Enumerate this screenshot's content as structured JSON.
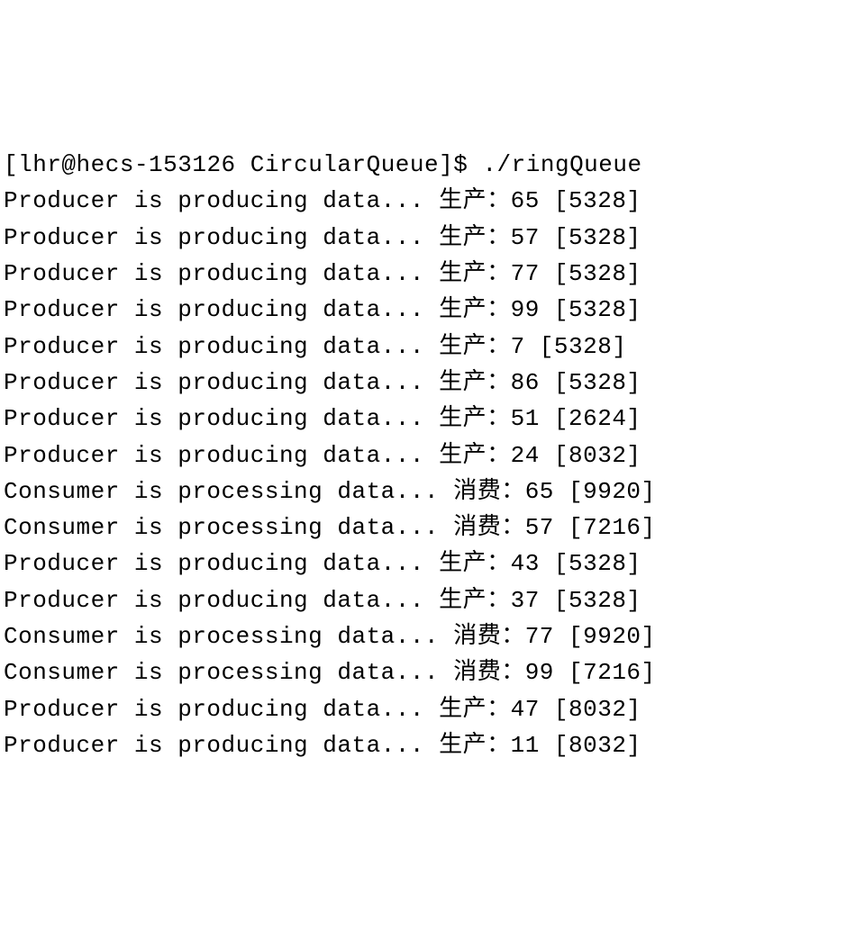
{
  "prompt": {
    "user": "lhr",
    "host": "hecs-153126",
    "directory": "CircularQueue",
    "symbol": "$",
    "command": "./ringQueue"
  },
  "lines": [
    {
      "type": "producer",
      "prefix": "Producer is producing data... ",
      "label": "生产：",
      "value": "65",
      "pid": "5328"
    },
    {
      "type": "producer",
      "prefix": "Producer is producing data... ",
      "label": "生产：",
      "value": "57",
      "pid": "5328"
    },
    {
      "type": "producer",
      "prefix": "Producer is producing data... ",
      "label": "生产：",
      "value": "77",
      "pid": "5328"
    },
    {
      "type": "producer",
      "prefix": "Producer is producing data... ",
      "label": "生产：",
      "value": "99",
      "pid": "5328"
    },
    {
      "type": "producer",
      "prefix": "Producer is producing data... ",
      "label": "生产：",
      "value": "7",
      "pid": "5328"
    },
    {
      "type": "producer",
      "prefix": "Producer is producing data... ",
      "label": "生产：",
      "value": "86",
      "pid": "5328"
    },
    {
      "type": "producer",
      "prefix": "Producer is producing data... ",
      "label": "生产：",
      "value": "51",
      "pid": "2624"
    },
    {
      "type": "producer",
      "prefix": "Producer is producing data... ",
      "label": "生产：",
      "value": "24",
      "pid": "8032"
    },
    {
      "type": "consumer",
      "prefix": "Consumer is processing data... ",
      "label": "消费：",
      "value": "65",
      "pid": "9920"
    },
    {
      "type": "consumer",
      "prefix": "Consumer is processing data... ",
      "label": "消费：",
      "value": "57",
      "pid": "7216"
    },
    {
      "type": "producer",
      "prefix": "Producer is producing data... ",
      "label": "生产：",
      "value": "43",
      "pid": "5328"
    },
    {
      "type": "producer",
      "prefix": "Producer is producing data... ",
      "label": "生产：",
      "value": "37",
      "pid": "5328"
    },
    {
      "type": "consumer",
      "prefix": "Consumer is processing data... ",
      "label": "消费：",
      "value": "77",
      "pid": "9920"
    },
    {
      "type": "consumer",
      "prefix": "Consumer is processing data... ",
      "label": "消费：",
      "value": "99",
      "pid": "7216"
    },
    {
      "type": "producer",
      "prefix": "Producer is producing data... ",
      "label": "生产：",
      "value": "47",
      "pid": "8032"
    },
    {
      "type": "producer",
      "prefix": "Producer is producing data... ",
      "label": "生产：",
      "value": "11",
      "pid": "8032"
    }
  ]
}
